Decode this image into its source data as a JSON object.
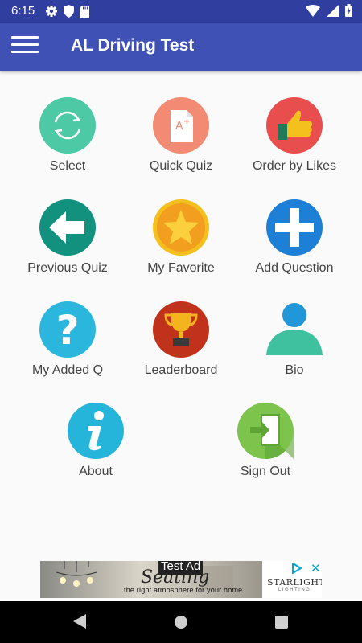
{
  "status_bar": {
    "time": "6:15",
    "icons": [
      "settings-icon",
      "shield-icon",
      "sd-card-icon",
      "wifi-icon",
      "signal-icon",
      "battery-icon"
    ]
  },
  "app_bar": {
    "title": "AL Driving Test",
    "menu_icon": "hamburger-menu-icon",
    "color": "#3f51b5"
  },
  "menu_grid": [
    {
      "label": "Select",
      "icon": "refresh-icon",
      "color": "#4ec9a6"
    },
    {
      "label": "Quick Quiz",
      "icon": "quiz-paper-icon",
      "color": "#f38a73"
    },
    {
      "label": "Order by Likes",
      "icon": "thumbs-up-icon",
      "color": "#e84e4e"
    },
    {
      "label": "Previous Quiz",
      "icon": "back-arrow-icon",
      "color": "#13917f"
    },
    {
      "label": "My Favorite",
      "icon": "star-icon",
      "color": "#f4c01e"
    },
    {
      "label": "Add Question",
      "icon": "plus-icon",
      "color": "#1d7fd6"
    },
    {
      "label": "My Added Q",
      "icon": "question-mark-icon",
      "color": "#2bb7dd"
    },
    {
      "label": "Leaderboard",
      "icon": "trophy-icon",
      "color": "#c0321c"
    },
    {
      "label": "Bio",
      "icon": "person-icon",
      "color": "#3fc19f"
    },
    {
      "label": "About",
      "icon": "info-icon",
      "color": "#26b5da"
    },
    {
      "label": "Sign Out",
      "icon": "sign-out-icon",
      "color": "#7cc44b"
    }
  ],
  "ad_banner": {
    "badge": "Test Ad",
    "headline": "Seating",
    "tagline": "the right atmosphere    for your home",
    "brand": "STARLIGHT",
    "brand_sub": "LIGHTING",
    "close": "✕"
  },
  "nav_bar": {
    "icons": [
      "back-icon",
      "home-icon",
      "recents-icon"
    ]
  }
}
